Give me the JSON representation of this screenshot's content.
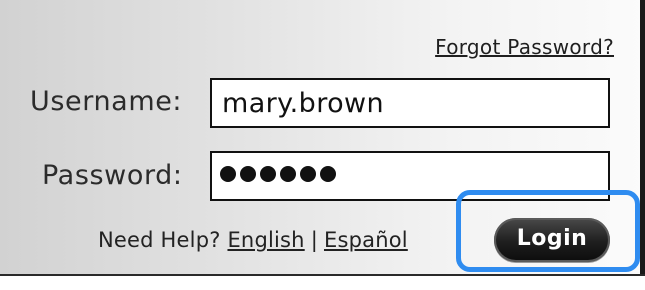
{
  "form": {
    "forgot_password": "Forgot Password?",
    "username_label": "Username:",
    "username_value": "mary.brown",
    "password_label": "Password:",
    "password_mask_length": 6,
    "help_prefix": "Need Help?",
    "help_english": "English",
    "help_separator": "|",
    "help_espanol": "Español",
    "login_label": "Login"
  },
  "highlight": {
    "color": "#2f8cf0",
    "target": "login-button"
  }
}
